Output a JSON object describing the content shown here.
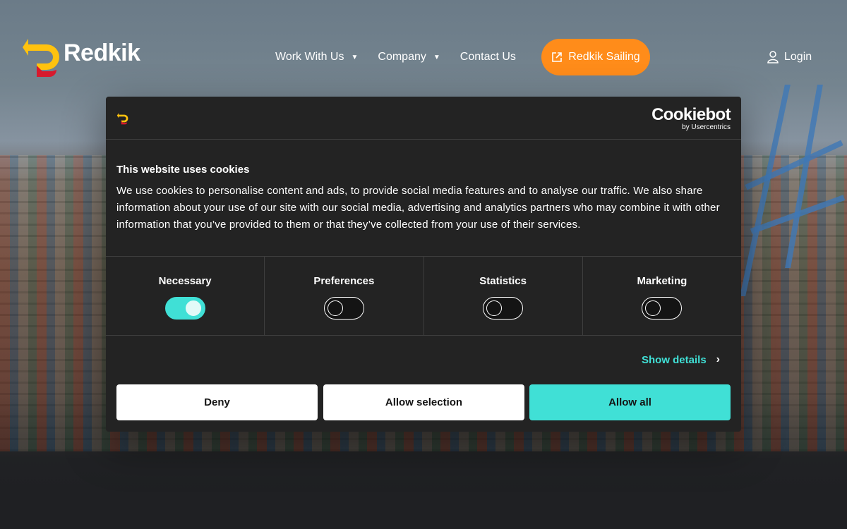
{
  "brand": {
    "name": "Redkik",
    "accent": "#ff8c1a",
    "logo_yellow": "#ffc20e",
    "logo_red": "#d7192d"
  },
  "nav": {
    "items": [
      {
        "label": "Work With Us",
        "has_dropdown": true
      },
      {
        "label": "Company",
        "has_dropdown": true
      },
      {
        "label": "Contact Us",
        "has_dropdown": false
      }
    ],
    "cta_label": "Redkik Sailing",
    "cta_icon": "external-link-icon",
    "login_label": "Login",
    "login_icon": "user-icon"
  },
  "cookie_dialog": {
    "provider": "Cookiebot",
    "provider_sub": "by Usercentrics",
    "title": "This website uses cookies",
    "body": "We use cookies to personalise content and ads, to provide social media features and to analyse our traffic. We also share information about your use of our site with our social media, advertising and analytics partners who may combine it with other information that you’ve provided to them or that they’ve collected from your use of their services.",
    "categories": [
      {
        "label": "Necessary",
        "enabled": true
      },
      {
        "label": "Preferences",
        "enabled": false
      },
      {
        "label": "Statistics",
        "enabled": false
      },
      {
        "label": "Marketing",
        "enabled": false
      }
    ],
    "show_details_label": "Show details",
    "buttons": {
      "deny": "Deny",
      "allow_selection": "Allow selection",
      "allow_all": "Allow all"
    },
    "accent": "#40e0d6"
  }
}
